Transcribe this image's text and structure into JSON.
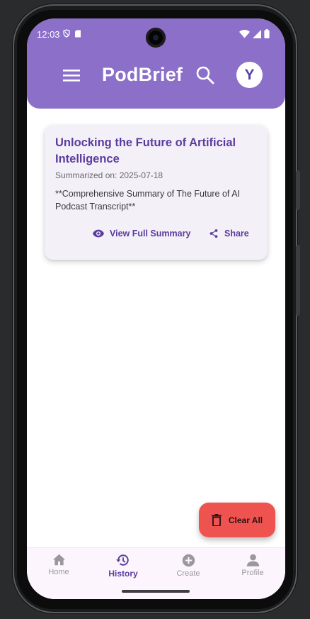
{
  "status_bar": {
    "time": "12:03"
  },
  "app_bar": {
    "title": "PodBrief",
    "avatar_initial": "Y"
  },
  "history": {
    "items": [
      {
        "title": "Unlocking the Future of Artificial Intelligence",
        "date": "Summarized on: 2025-07-18",
        "snippet": "**Comprehensive Summary of The Future of AI Podcast Transcript**",
        "view_label": "View Full Summary",
        "share_label": "Share"
      }
    ]
  },
  "fab": {
    "label": "Clear All"
  },
  "bottom_nav": {
    "items": [
      {
        "label": "Home",
        "icon": "home-icon"
      },
      {
        "label": "History",
        "icon": "history-icon",
        "active": true
      },
      {
        "label": "Create",
        "icon": "add-circle-icon"
      },
      {
        "label": "Profile",
        "icon": "person-icon"
      }
    ]
  },
  "colors": {
    "header": "#8b6fc9",
    "accent": "#5a3c9e",
    "danger": "#ef5350",
    "nav_background": "#fcf5fd"
  }
}
